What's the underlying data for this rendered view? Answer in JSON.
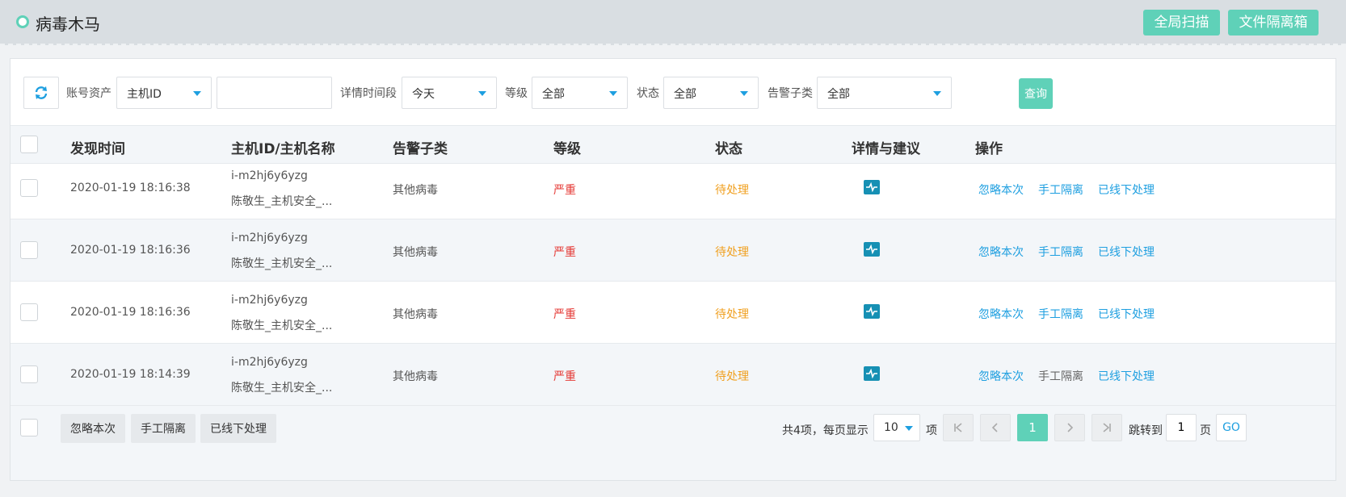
{
  "header": {
    "title": "病毒木马",
    "scan_label": "全局扫描",
    "quarantine_label": "文件隔离箱"
  },
  "filters": {
    "account_label": "账号资产",
    "account_select": "主机ID",
    "account_input_value": "",
    "time_label": "详情时间段",
    "time_select": "今天",
    "level_label": "等级",
    "level_select": "全部",
    "state_label": "状态",
    "state_select": "全部",
    "sub_label": "告警子类",
    "sub_select": "全部",
    "query_label": "查询"
  },
  "columns": {
    "time": "发现时间",
    "host": "主机ID/主机名称",
    "sub": "告警子类",
    "level": "等级",
    "state": "状态",
    "detail": "详情与建议",
    "ops": "操作"
  },
  "rows": [
    {
      "time": "2020-01-19 18:16:38",
      "host_id": "i-m2hj6y6yzg",
      "host_name": "陈敬生_主机安全_...",
      "sub": "其他病毒",
      "level": "严重",
      "state": "待处理",
      "op_ignore": "忽略本次",
      "op_isolate": "手工隔离",
      "op_offline": "已线下处理"
    },
    {
      "time": "2020-01-19 18:16:36",
      "host_id": "i-m2hj6y6yzg",
      "host_name": "陈敬生_主机安全_...",
      "sub": "其他病毒",
      "level": "严重",
      "state": "待处理",
      "op_ignore": "忽略本次",
      "op_isolate": "手工隔离",
      "op_offline": "已线下处理"
    },
    {
      "time": "2020-01-19 18:16:36",
      "host_id": "i-m2hj6y6yzg",
      "host_name": "陈敬生_主机安全_...",
      "sub": "其他病毒",
      "level": "严重",
      "state": "待处理",
      "op_ignore": "忽略本次",
      "op_isolate": "手工隔离",
      "op_offline": "已线下处理"
    },
    {
      "time": "2020-01-19 18:14:39",
      "host_id": "i-m2hj6y6yzg",
      "host_name": "陈敬生_主机安全_...",
      "sub": "其他病毒",
      "level": "严重",
      "state": "待处理",
      "op_ignore": "忽略本次",
      "op_isolate": "手工隔离",
      "op_offline": "已线下处理"
    }
  ],
  "footer": {
    "batch_ignore": "忽略本次",
    "batch_isolate": "手工隔离",
    "batch_offline": "已线下处理",
    "total_text": "共4项，每页显示",
    "page_size": "10",
    "unit_text": "项",
    "current_page": "1",
    "jump_label": "跳转到",
    "jump_value": "1",
    "page_unit": "页",
    "go_label": "GO"
  },
  "colors": {
    "accent": "#5fd1b8",
    "link": "#1e9fe0",
    "danger": "#e53935",
    "warning": "#f0a020",
    "detail_icon": "#1690b4"
  },
  "icons": {
    "refresh": "refresh-icon",
    "detail": "pulse-chart-icon",
    "first_page": "first-page-icon",
    "prev_page": "chevron-left-icon",
    "next_page": "chevron-right-icon",
    "last_page": "last-page-icon"
  }
}
